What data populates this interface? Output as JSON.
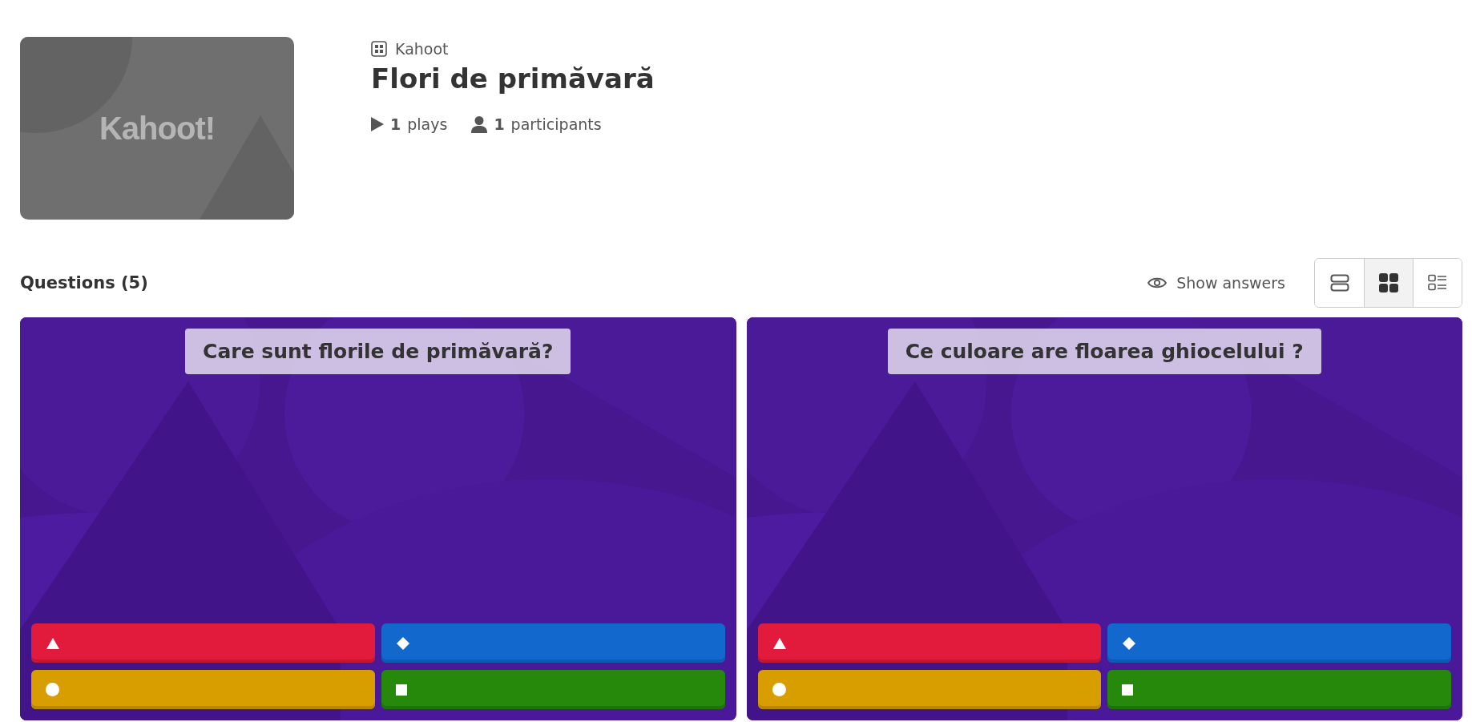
{
  "kahoot": {
    "thumbnail_logo": "Kahoot!",
    "type_label": "Kahoot",
    "title": "Flori de primăvară",
    "plays_count": "1",
    "plays_label": "plays",
    "participants_count": "1",
    "participants_label": "participants"
  },
  "questions_header": {
    "title": "Questions (5)",
    "show_answers": "Show answers",
    "view_modes": [
      {
        "kind": "rows",
        "selected": false
      },
      {
        "kind": "grid",
        "selected": true
      },
      {
        "kind": "list",
        "selected": false
      }
    ]
  },
  "questions": [
    {
      "text": "Care sunt florile de primăvară?",
      "answers": [
        {
          "kind": "triangle"
        },
        {
          "kind": "diamond"
        },
        {
          "kind": "circle"
        },
        {
          "kind": "square"
        }
      ]
    },
    {
      "text": "Ce culoare are floarea ghiocelului ?",
      "answers": [
        {
          "kind": "triangle"
        },
        {
          "kind": "diamond"
        },
        {
          "kind": "circle"
        },
        {
          "kind": "square"
        }
      ]
    }
  ]
}
